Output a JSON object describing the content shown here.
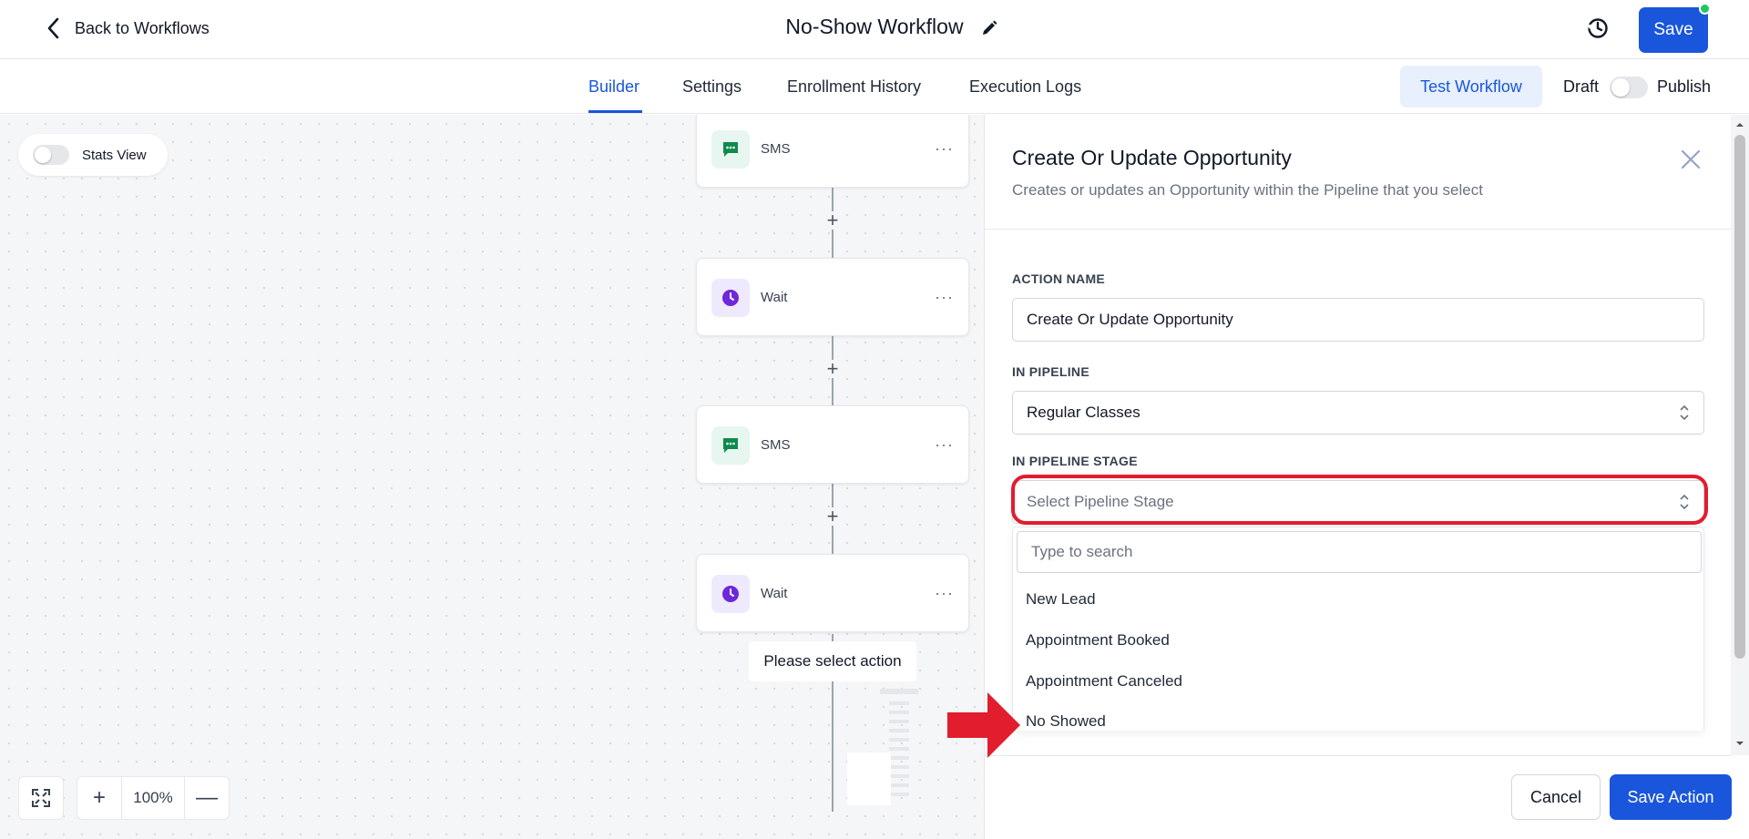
{
  "header": {
    "back_label": "Back to Workflows",
    "workflow_title": "No-Show Workflow",
    "save_label": "Save",
    "status_dot_color": "#22c55e"
  },
  "tabs": [
    {
      "label": "Builder",
      "active": true
    },
    {
      "label": "Settings"
    },
    {
      "label": "Enrollment History"
    },
    {
      "label": "Execution Logs"
    }
  ],
  "toolbar": {
    "test_label": "Test Workflow",
    "draft_label": "Draft",
    "publish_label": "Publish",
    "published": false
  },
  "canvas": {
    "stats_label": "Stats View",
    "stats_enabled": false,
    "nodes": [
      {
        "label": "SMS",
        "icon": "message-icon"
      },
      {
        "label": "Wait",
        "icon": "clock-icon"
      },
      {
        "label": "SMS",
        "icon": "message-icon"
      },
      {
        "label": "Wait",
        "icon": "clock-icon"
      }
    ],
    "more_symbol": "···",
    "add_symbol": "+",
    "select_action_label": "Please select action",
    "zoom_level": "100%",
    "zoom_in_symbol": "+",
    "zoom_out_symbol": "—"
  },
  "panel": {
    "title": "Create Or Update Opportunity",
    "subtitle": "Creates or updates an Opportunity within the Pipeline that you select",
    "action_name_label": "ACTION NAME",
    "action_name_value": "Create Or Update Opportunity",
    "pipeline_label": "IN PIPELINE",
    "pipeline_value": "Regular Classes",
    "stage_label": "IN PIPELINE STAGE",
    "stage_placeholder": "Select Pipeline Stage",
    "search_placeholder": "Type to search",
    "stage_options": [
      "New Lead",
      "Appointment Booked",
      "Appointment Canceled",
      "No Showed"
    ],
    "cancel_label": "Cancel",
    "save_action_label": "Save Action"
  },
  "colors": {
    "accent": "#1a56db",
    "highlight_ring": "#e11d2e",
    "sms_icon": "#0f8a4f",
    "wait_icon": "#6d28d9"
  }
}
